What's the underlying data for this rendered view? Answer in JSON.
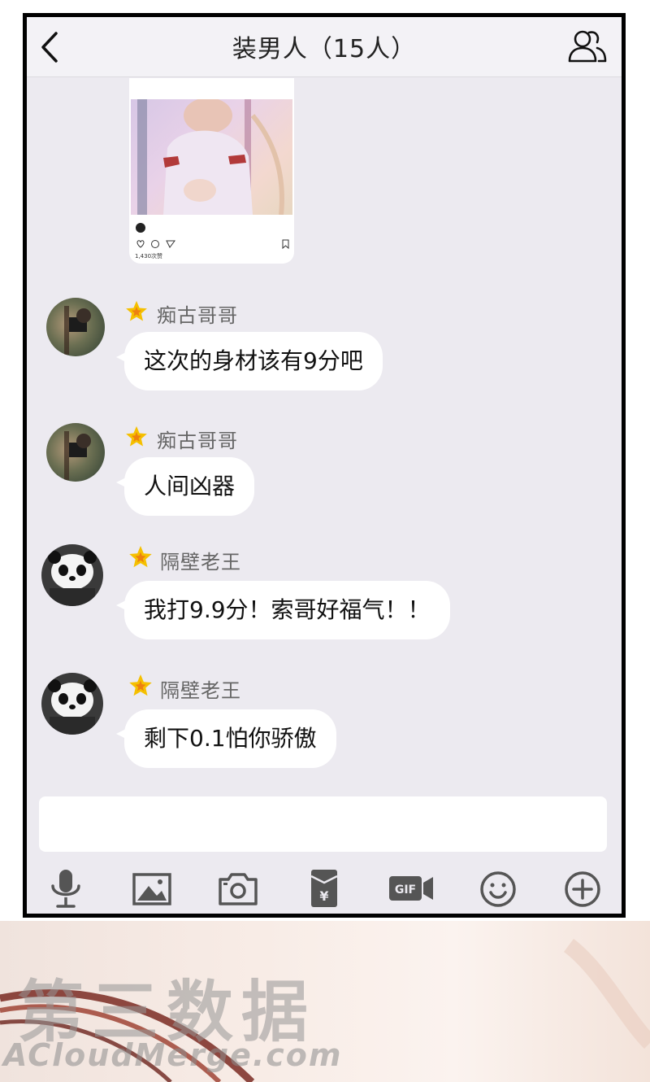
{
  "header": {
    "title": "装男人（15人）"
  },
  "shared_post": {
    "likes_text": "1,430次赞"
  },
  "messages": [
    {
      "sender": "痴古哥哥",
      "avatar": "photo",
      "text": "这次的身材该有9分吧"
    },
    {
      "sender": "痴古哥哥",
      "avatar": "photo",
      "text": "人间凶器"
    },
    {
      "sender": "隔壁老王",
      "avatar": "panda",
      "text": "我打9.9分！索哥好福气！！"
    },
    {
      "sender": "隔壁老王",
      "avatar": "panda",
      "text": "剩下0.1怕你骄傲"
    }
  ],
  "toolbar": {
    "icons": [
      "microphone-icon",
      "image-icon",
      "camera-icon",
      "red-packet-icon",
      "gif-icon",
      "emoji-icon",
      "plus-icon"
    ]
  },
  "watermark": {
    "title": "第三数据",
    "subtitle": "ACloudMerge.com"
  },
  "colors": {
    "chat_background": "#eceaf0",
    "bubble": "#ffffff",
    "star": "#f5c000",
    "icon": "#555555"
  }
}
